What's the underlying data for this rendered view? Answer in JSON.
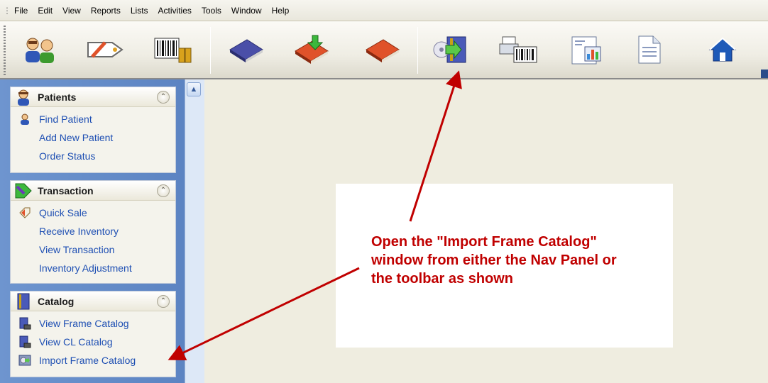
{
  "menubar": {
    "items": [
      "File",
      "Edit",
      "View",
      "Reports",
      "Lists",
      "Activities",
      "Tools",
      "Window",
      "Help"
    ]
  },
  "toolbar": {
    "buttons": [
      {
        "icon": "patients-icon"
      },
      {
        "icon": "tag-icon"
      },
      {
        "icon": "barcode-icon"
      },
      {
        "icon": "blue-book-icon"
      },
      {
        "icon": "book-download-icon"
      },
      {
        "icon": "orange-book-icon"
      },
      {
        "icon": "import-catalog-icon"
      },
      {
        "icon": "barcode-printer-icon"
      },
      {
        "icon": "report-chart-icon"
      },
      {
        "icon": "document-icon"
      },
      {
        "icon": "home-icon"
      }
    ]
  },
  "nav": {
    "groups": [
      {
        "title": "Patients",
        "items": [
          "Find Patient",
          "Add New Patient",
          "Order Status"
        ]
      },
      {
        "title": "Transaction",
        "items": [
          "Quick Sale",
          "Receive Inventory",
          "View Transaction",
          "Inventory Adjustment"
        ]
      },
      {
        "title": "Catalog",
        "items": [
          "View Frame Catalog",
          "View CL Catalog",
          "Import Frame Catalog"
        ]
      }
    ]
  },
  "annotation": {
    "line1": "Open the \"Import Frame Catalog\"",
    "line2": "window from either the Nav Panel or",
    "line3": "the toolbar as shown",
    "color": "#c00000"
  },
  "colors": {
    "nav_background": "#5f88c6",
    "link": "#1e4fb3"
  }
}
